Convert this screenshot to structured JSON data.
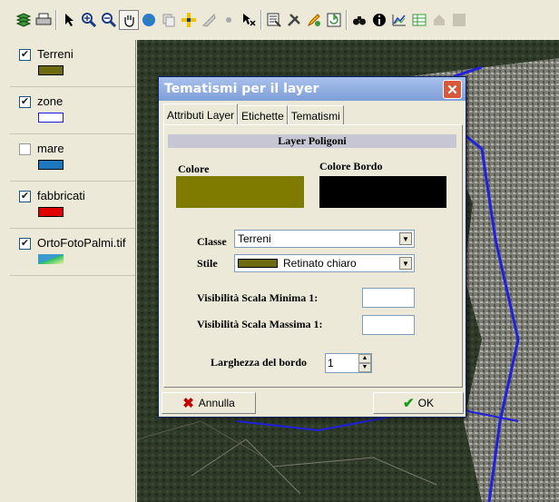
{
  "toolbar": {
    "icons": [
      "layers-icon",
      "print-icon",
      "select-arrow-icon",
      "zoom-in-icon",
      "zoom-out-icon",
      "pan-hand-icon",
      "globe-icon",
      "copy-icon",
      "crosshair-icon",
      "ruler-icon",
      "point-icon",
      "identify-icon",
      "properties-icon",
      "tools-icon",
      "edit-icon",
      "refresh-icon",
      "binoculars-icon",
      "info-icon",
      "chart-icon",
      "table-icon",
      "home-icon",
      "grid-icon"
    ]
  },
  "layers": [
    {
      "name": "Terreni",
      "checked": true,
      "swatch": "#6e6a10"
    },
    {
      "name": "zone",
      "checked": true,
      "swatch": "#ffffff",
      "border": "#1a1ae0"
    },
    {
      "name": "mare",
      "checked": false,
      "swatch": "#1e78c0"
    },
    {
      "name": "fabbricati",
      "checked": true,
      "swatch": "#e00000"
    },
    {
      "name": "OrtoFotoPalmi.tif",
      "checked": true,
      "swatch": "image"
    }
  ],
  "dialog": {
    "title": "Tematismi per il layer",
    "close": "✕",
    "tabs": [
      "Attributi Layer",
      "Etichette",
      "Tematismi"
    ],
    "section_title": "Layer Poligoni",
    "colore_label": "Colore",
    "colore_bordo_label": "Colore Bordo",
    "colore_value": "#7f7a00",
    "colore_bordo_value": "#000000",
    "classe_label": "Classe",
    "classe_value": "Terreni",
    "stile_label": "Stile",
    "stile_value": "Retinato chiaro",
    "vis_min_label": "Visibilità Scala Minima 1:",
    "vis_max_label": "Visibilità Scala Massima 1:",
    "vis_min_value": "",
    "vis_max_value": "",
    "larghezza_label": "Larghezza del bordo",
    "larghezza_value": "1",
    "cancel_label": "Annulla",
    "ok_label": "OK"
  }
}
